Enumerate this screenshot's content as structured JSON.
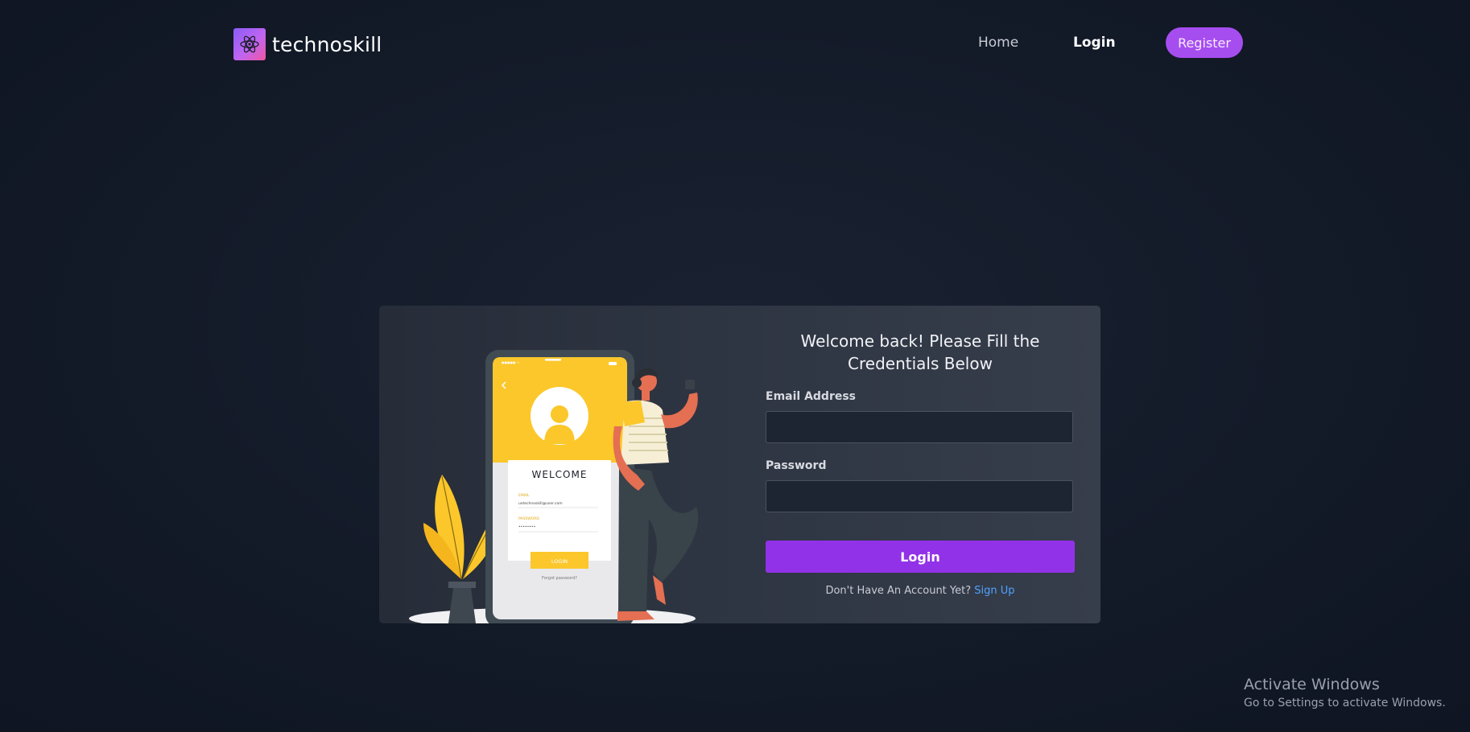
{
  "nav": {
    "brand_name": "technoskill",
    "home_label": "Home",
    "login_label": "Login",
    "register_label": "Register"
  },
  "illustration": {
    "phone_title": "WELCOME",
    "email_label": "EMAIL",
    "email_value": "uxtechnoskill@user.com",
    "password_label": "PASSWORD",
    "password_value": "••••••••",
    "login_label": "LOGIN",
    "forgot_label": "Forgot password?"
  },
  "form": {
    "title_line1": "Welcome back! Please Fill the",
    "title_line2": "Credentials Below",
    "email_label": "Email Address",
    "email_value": "",
    "password_label": "Password",
    "password_value": "",
    "login_button": "Login",
    "signup_prompt": "Don't Have An Account Yet? ",
    "signup_link": "Sign Up"
  },
  "watermark": {
    "title": "Activate Windows",
    "subtitle": "Go to Settings to activate Windows."
  },
  "colors": {
    "accent_purple": "#9232e8",
    "register_bg": "#a64df0",
    "link_blue": "#4ea3ff",
    "illus_yellow": "#fbc72b"
  }
}
